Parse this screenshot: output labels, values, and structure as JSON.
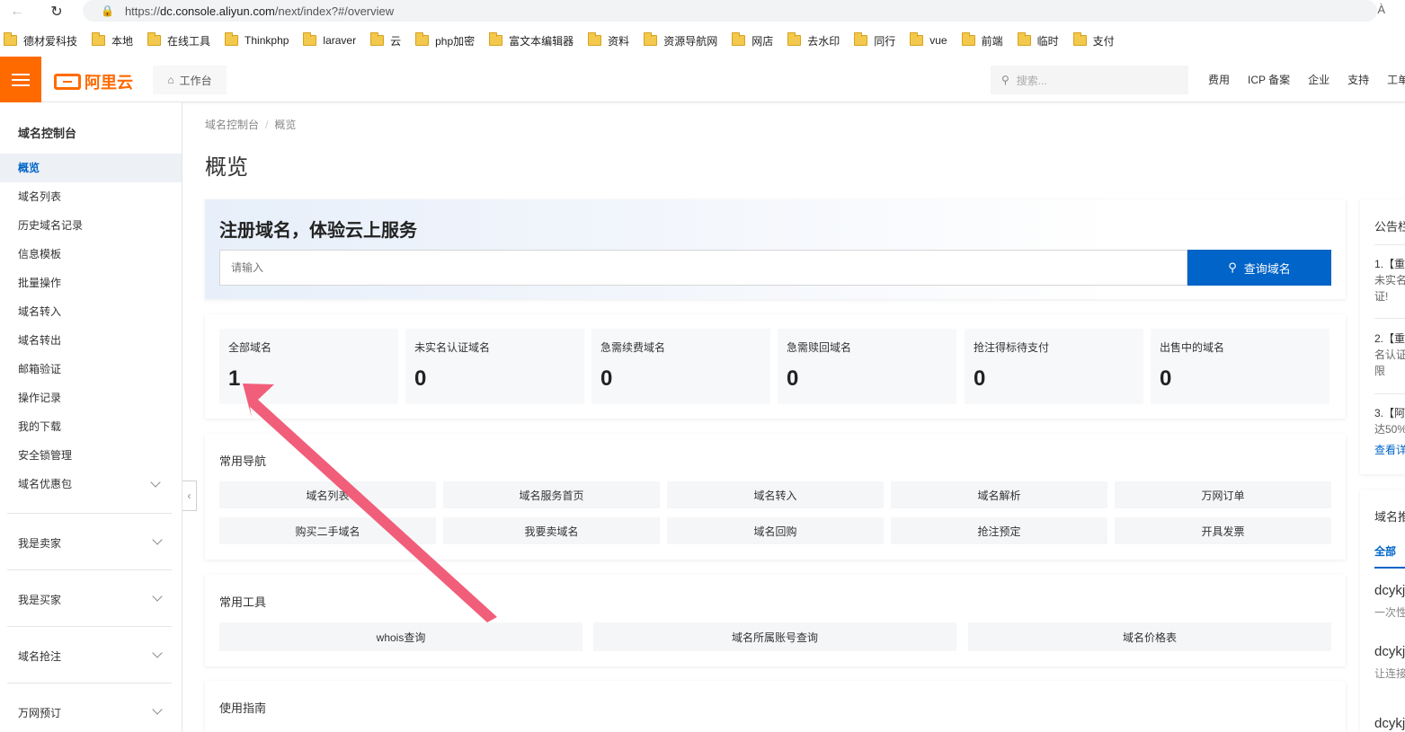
{
  "browser": {
    "url_prefix": "https://",
    "url_host": "dc.console.aliyun.com",
    "url_path": "/next/index?#/overview",
    "read_aloud": "À",
    "bookmarks": [
      "德材爱科技",
      "本地",
      "在线工具",
      "Thinkphp",
      "laraver",
      "云",
      "php加密",
      "富文本编辑器",
      "资料",
      "资源导航网",
      "网店",
      "去水印",
      "同行",
      "vue",
      "前端",
      "临时",
      "支付"
    ]
  },
  "header": {
    "logo_text": "阿里云",
    "workbench": "工作台",
    "search_placeholder": "搜索...",
    "links": [
      "费用",
      "ICP 备案",
      "企业",
      "支持",
      "工单"
    ]
  },
  "sidebar": {
    "title": "域名控制台",
    "items": [
      "概览",
      "域名列表",
      "历史域名记录",
      "信息模板",
      "批量操作",
      "域名转入",
      "域名转出",
      "邮箱验证",
      "操作记录",
      "我的下载",
      "安全锁管理",
      "域名优惠包"
    ],
    "groups": [
      "我是卖家",
      "我是买家",
      "域名抢注",
      "万网预订"
    ]
  },
  "main": {
    "breadcrumb": [
      "域名控制台",
      "概览"
    ],
    "breadcrumb_sep": "/",
    "page_title": "概览",
    "banner": {
      "title": "注册域名，体验云上服务",
      "input_placeholder": "请输入",
      "button": "查询域名"
    },
    "stats": [
      {
        "label": "全部域名",
        "value": "1"
      },
      {
        "label": "未实名认证域名",
        "value": "0"
      },
      {
        "label": "急需续费域名",
        "value": "0"
      },
      {
        "label": "急需赎回域名",
        "value": "0"
      },
      {
        "label": "抢注得标待支付",
        "value": "0"
      },
      {
        "label": "出售中的域名",
        "value": "0"
      }
    ],
    "nav_title": "常用导航",
    "nav_links": [
      "域名列表",
      "域名服务首页",
      "域名转入",
      "域名解析",
      "万网订单",
      "购买二手域名",
      "我要卖域名",
      "域名回购",
      "抢注预定",
      "开具发票"
    ],
    "tools_title": "常用工具",
    "tools": [
      "whois查询",
      "域名所属账号查询",
      "域名价格表"
    ],
    "guide_title": "使用指南"
  },
  "right": {
    "notice_title": "公告栏",
    "notice_lines": [
      "1.【重",
      "未实名",
      "证!",
      "2.【重",
      "名认证",
      "限",
      "3.【阿",
      "达50%",
      "查看详"
    ],
    "domain_title": "域名推",
    "domain_tab": "全部",
    "domain_lines": [
      "dcykj",
      "一次性",
      "dcykj",
      "让连接",
      "dcykj"
    ]
  },
  "colors": {
    "brand_orange": "#ff6a00",
    "primary_blue": "#0064c8",
    "annotation_arrow": "#f0506e"
  }
}
